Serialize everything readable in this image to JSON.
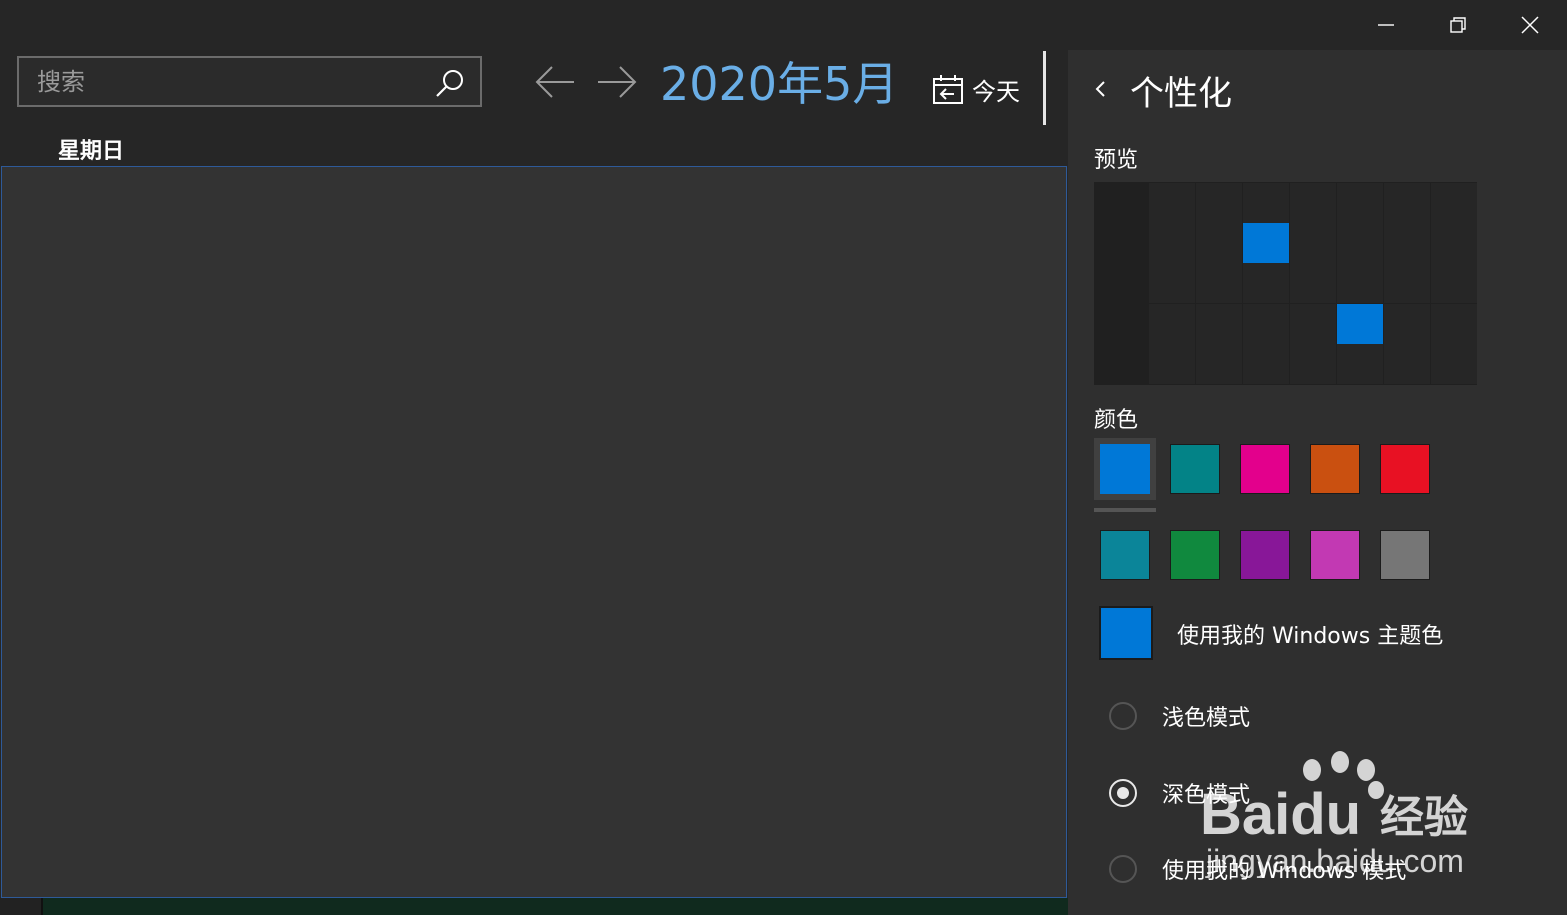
{
  "search": {
    "placeholder": "搜索",
    "value": ""
  },
  "header": {
    "month": "2020年5月",
    "today_label": "今天"
  },
  "calendar": {
    "weekday": "星期日"
  },
  "panel": {
    "title": "个性化",
    "preview_label": "预览",
    "color_label": "颜色",
    "swatches_row1": [
      "#0078d7",
      "#038387",
      "#e3008c",
      "#ca5010",
      "#e81123"
    ],
    "swatches_row2": [
      "#0b8599",
      "#10893e",
      "#881798",
      "#c239b3",
      "#767676"
    ],
    "selected_swatch": "#0078d7",
    "theme_color_label": "使用我的 Windows 主题色",
    "modes": [
      {
        "label": "浅色模式",
        "checked": false
      },
      {
        "label": "深色模式",
        "checked": true
      },
      {
        "label": "使用我的 Windows 模式",
        "checked": false
      }
    ]
  },
  "watermark": {
    "brand": "Baidu",
    "brand_suffix": "经验",
    "url": "jingyan.baidu.com"
  },
  "colors": {
    "accent": "#0078d7",
    "month_text": "#6aaee6",
    "panel_bg": "#2f2f2f"
  }
}
